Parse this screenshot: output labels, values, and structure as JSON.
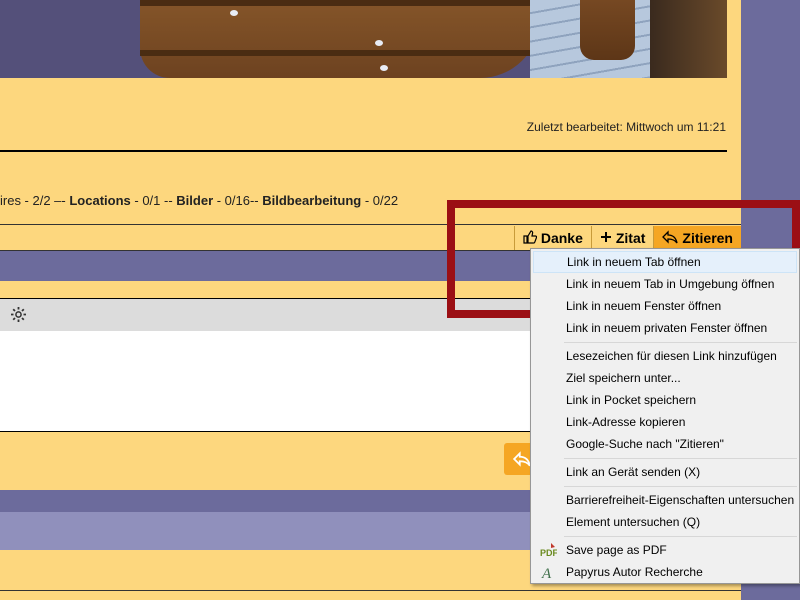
{
  "post": {
    "last_edited": "Zuletzt bearbeitet: Mittwoch um 11:21",
    "signature": [
      {
        "text": "ires - 2/2 –- ",
        "bold": false
      },
      {
        "text": "Locations",
        "bold": true
      },
      {
        "text": " - 0/1 -- ",
        "bold": false
      },
      {
        "text": "Bilder",
        "bold": true
      },
      {
        "text": " - 0/16-- ",
        "bold": false
      },
      {
        "text": "Bildbearbeitung",
        "bold": true
      },
      {
        "text": " - 0/22",
        "bold": false
      }
    ],
    "actions": {
      "danke": {
        "label": "Danke",
        "icon": "thumbs-up-icon"
      },
      "zitat": {
        "label": "Zitat",
        "icon": "plus-icon"
      },
      "zitieren": {
        "label": "Zitieren",
        "icon": "reply-icon"
      }
    }
  },
  "editor": {
    "settings_icon": "gear-icon"
  },
  "context_menu": {
    "items": [
      "Link in neuem Tab öffnen",
      "Link in neuem Tab in Umgebung öffnen",
      "Link in neuem Fenster öffnen",
      "Link in neuem privaten Fenster öffnen",
      "Lesezeichen für diesen Link hinzufügen",
      "Ziel speichern unter...",
      "Link in Pocket speichern",
      "Link-Adresse kopieren",
      "Google-Suche nach \"Zitieren\"",
      "Link an Gerät senden (X)",
      "Barrierefreiheit-Eigenschaften untersuchen",
      "Element untersuchen (Q)",
      "Save page as PDF",
      "Papyrus Autor Recherche"
    ]
  },
  "colors": {
    "page_bg": "#6c6b9c",
    "post_bg": "#fdd77e",
    "accent": "#f5a623",
    "highlight_box": "#9b0f14"
  }
}
